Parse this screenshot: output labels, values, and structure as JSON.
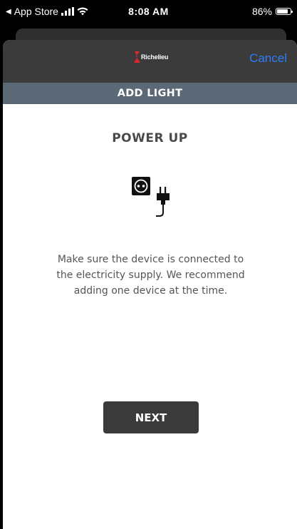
{
  "status_bar": {
    "back_label": "App Store",
    "time": "8:08 AM",
    "battery": "86%",
    "battery_level": 0.86,
    "icons": [
      "back-arrow-icon",
      "signal-icon",
      "wifi-icon",
      "battery-icon"
    ]
  },
  "nav": {
    "logo_text": "Richelieu",
    "cancel_label": "Cancel",
    "brand_color": "#e0262c",
    "cancel_color": "#2f7cf6"
  },
  "title_bar": {
    "title": "ADD LIGHT",
    "color": "#5b6876"
  },
  "main": {
    "heading": "POWER UP",
    "illustration_icon": "power-socket-plug-icon",
    "instructions": "Make sure the device is connected to the electricity supply. We recommend adding one device at the time.",
    "next_label": "NEXT"
  }
}
